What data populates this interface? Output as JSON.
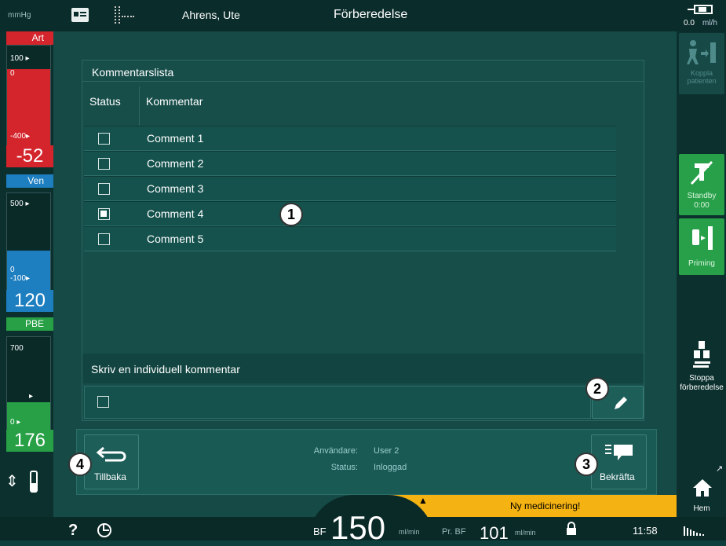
{
  "topbar": {
    "unit": "mmHg",
    "patient_name": "Ahrens, Ute",
    "screen_title": "Förberedelse",
    "rate_value": "0.0",
    "rate_unit": "ml/h"
  },
  "gauges": {
    "art": {
      "label": "Art",
      "scale_top": "100",
      "scale_zero": "0",
      "scale_bottom": "-400",
      "value": "-52",
      "color": "#d3252b"
    },
    "ven": {
      "label": "Ven",
      "scale_top": "500",
      "scale_zero": "0",
      "scale_bottom": "-100",
      "value": "120",
      "color": "#1d7ec0"
    },
    "pbe": {
      "label": "PBE",
      "scale_top": "700",
      "scale_zero": "0",
      "value": "176",
      "color": "#27a046"
    }
  },
  "comment_list": {
    "title": "Kommentarslista",
    "col_status": "Status",
    "col_comment": "Kommentar",
    "items": [
      {
        "label": "Comment 1",
        "checked": false
      },
      {
        "label": "Comment 2",
        "checked": false
      },
      {
        "label": "Comment 3",
        "checked": false
      },
      {
        "label": "Comment 4",
        "checked": true
      },
      {
        "label": "Comment 5",
        "checked": false
      }
    ],
    "individual_title": "Skriv en individuell kommentar"
  },
  "footer": {
    "user_label": "Användare:",
    "user_value": "User 2",
    "status_label": "Status:",
    "status_value": "Inloggad",
    "back_label": "Tillbaka",
    "confirm_label": "Bekräfta"
  },
  "callouts": [
    "1",
    "2",
    "3",
    "4"
  ],
  "right_buttons": {
    "connect_patient": "Koppla patienten",
    "standby": "Standby",
    "standby_time": "0:00",
    "priming": "Priming",
    "stop_prep_1": "Stoppa",
    "stop_prep_2": "förberedelse",
    "home": "Hem"
  },
  "bottombar": {
    "help": "?",
    "bf_label": "BF",
    "bf_value": "150",
    "bf_unit": "ml/min",
    "prbf_label": "Pr. BF",
    "prbf_value": "101",
    "prbf_unit": "ml/min",
    "time": "11:58",
    "notification": "Ny medicinering!",
    "notification_color": "#f4b312"
  }
}
